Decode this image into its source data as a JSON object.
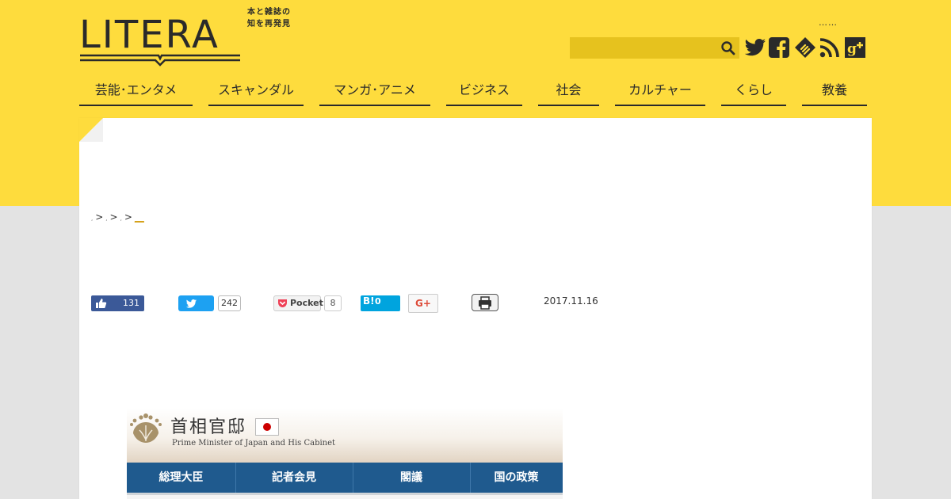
{
  "header": {
    "logo_text": "LITERA",
    "tagline_line1": "本と雑誌の",
    "tagline_line2": "知を再発見",
    "dots": "……",
    "search": {
      "placeholder": "",
      "value": ""
    },
    "social_icons": [
      "twitter-icon",
      "facebook-icon",
      "feedly-icon",
      "rss-icon",
      "google-plus-icon"
    ]
  },
  "nav": {
    "items": [
      {
        "label": "芸能･エンタメ"
      },
      {
        "label": "スキャンダル"
      },
      {
        "label": "マンガ･アニメ"
      },
      {
        "label": "ビジネス"
      },
      {
        "label": "社会"
      },
      {
        "label": "カルチャー"
      },
      {
        "label": "くらし"
      },
      {
        "label": "教養"
      }
    ]
  },
  "breadcrumb": {
    "sep": ">",
    "link_mark": ",",
    "current": "__"
  },
  "share": {
    "facebook_count": "131",
    "twitter_count": "242",
    "pocket_label": "Pocket",
    "pocket_count": "8",
    "hatena_label": "B!",
    "hatena_count": "0",
    "gplus_label": "G+"
  },
  "article": {
    "date": "2017.11.16"
  },
  "embed": {
    "title": "首相官邸",
    "subtitle": "Prime Minister of Japan and His Cabinet",
    "nav": [
      "総理大臣",
      "記者会見",
      "閣議",
      "国の政策"
    ]
  },
  "colors": {
    "brand_yellow": "#fedc3d",
    "search_bg": "#e6c21e",
    "facebook": "#3b5998",
    "twitter": "#1da1f2",
    "hatena": "#00a4de",
    "kantei_nav": "#1f5a8e"
  }
}
